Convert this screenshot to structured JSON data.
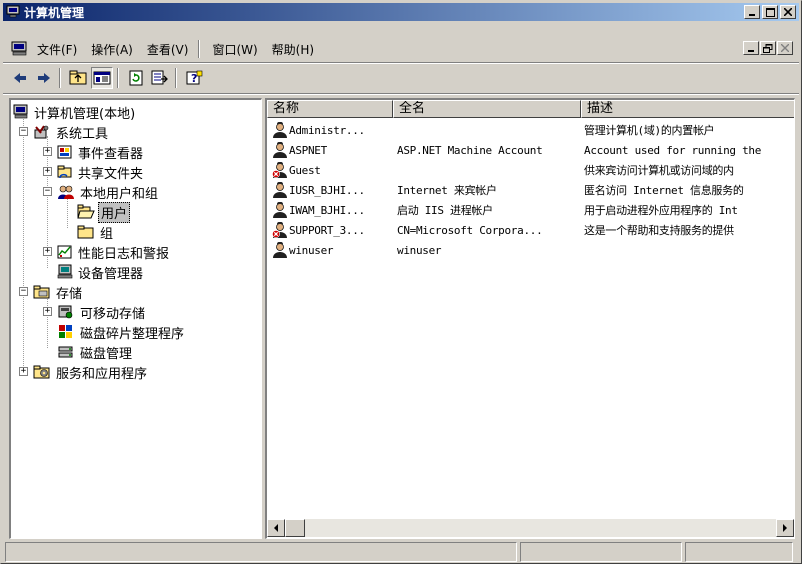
{
  "window": {
    "title": "计算机管理"
  },
  "menu": {
    "items": [
      "文件(F)",
      "操作(A)",
      "查看(V)",
      "窗口(W)",
      "帮助(H)"
    ]
  },
  "toolbar": {
    "buttons": [
      "back-arrow-icon",
      "forward-arrow-icon",
      "up-folder-icon",
      "show-hide-tree-icon",
      "refresh-icon",
      "export-list-icon",
      "help-icon"
    ]
  },
  "tree": {
    "root": "计算机管理(本地)",
    "items": [
      {
        "label": "系统工具"
      },
      {
        "label": "事件查看器"
      },
      {
        "label": "共享文件夹"
      },
      {
        "label": "本地用户和组"
      },
      {
        "label": "用户",
        "selected": true
      },
      {
        "label": "组"
      },
      {
        "label": "性能日志和警报"
      },
      {
        "label": "设备管理器"
      },
      {
        "label": "存储"
      },
      {
        "label": "可移动存储"
      },
      {
        "label": "磁盘碎片整理程序"
      },
      {
        "label": "磁盘管理"
      },
      {
        "label": "服务和应用程序"
      }
    ]
  },
  "list": {
    "columns": [
      "名称",
      "全名",
      "描述"
    ],
    "rows": [
      {
        "name": "Administr...",
        "fullname": "",
        "desc": "管理计算机(域)的内置帐户",
        "disabled": false
      },
      {
        "name": "ASPNET",
        "fullname": "ASP.NET Machine Account",
        "desc": "Account used for running the",
        "disabled": false
      },
      {
        "name": "Guest",
        "fullname": "",
        "desc": "供来宾访问计算机或访问域的内",
        "disabled": true
      },
      {
        "name": "IUSR_BJHI...",
        "fullname": "Internet 来宾帐户",
        "desc": "匿名访问 Internet 信息服务的",
        "disabled": false
      },
      {
        "name": "IWAM_BJHI...",
        "fullname": "启动 IIS 进程帐户",
        "desc": "用于启动进程外应用程序的 Int",
        "disabled": false
      },
      {
        "name": "SUPPORT_3...",
        "fullname": "CN=Microsoft Corpora...",
        "desc": "这是一个帮助和支持服务的提供",
        "disabled": true
      },
      {
        "name": "winuser",
        "fullname": "winuser",
        "desc": "",
        "disabled": false
      }
    ]
  },
  "colors": {
    "titlebar_start": "#0a246a",
    "titlebar_end": "#a6caf0",
    "face": "#d4d0c8"
  }
}
